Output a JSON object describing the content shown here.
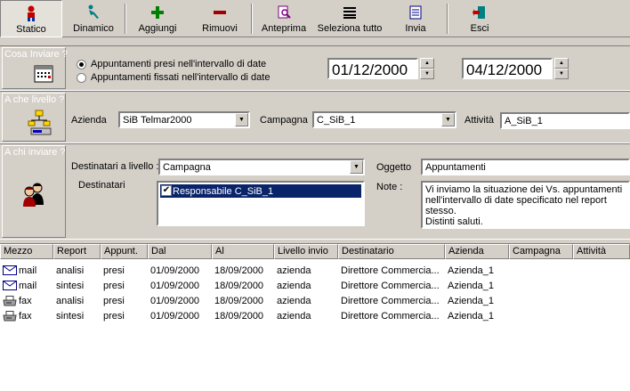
{
  "toolbar": {
    "statico": "Statico",
    "dinamico": "Dinamico",
    "aggiungi": "Aggiungi",
    "rimuovi": "Rimuovi",
    "anteprima": "Anteprima",
    "seleziona_tutto": "Seleziona tutto",
    "invia": "Invia",
    "esci": "Esci"
  },
  "cosa_inviare": {
    "title": "Cosa Inviare ?",
    "option1": "Appuntamenti presi nell'intervallo di date",
    "option2": "Appuntamenti fissati nell'intervallo di date",
    "date_from": "01/12/2000",
    "date_to": "04/12/2000"
  },
  "che_livello": {
    "title": "A che livello ?",
    "azienda_label": "Azienda",
    "azienda_value": "SiB Telmar2000",
    "campagna_label": "Campagna",
    "campagna_value": "C_SiB_1",
    "attivita_label": "Attività",
    "attivita_value": "A_SiB_1"
  },
  "chi_inviare": {
    "title": "A chi inviare ?",
    "destinatari_livello_label": "Destinatari a livello :",
    "destinatari_livello_value": "Campagna",
    "destinatari_label": "Destinatari",
    "destinatari_item": "Responsabile C_SiB_1",
    "oggetto_label": "Oggetto",
    "oggetto_value": "Appuntamenti",
    "note_label": "Note :",
    "note_line1": "Vi inviamo la situazione dei Vs. appuntamenti",
    "note_line2": "nell'intervallo di date specificato nel report stesso.",
    "note_line3": "Distinti saluti."
  },
  "grid": {
    "headers": [
      "Mezzo",
      "Report",
      "Appunt.",
      "Dal",
      "Al",
      "Livello invio",
      "Destinatario",
      "Azienda",
      "Campagna",
      "Attività"
    ],
    "rows": [
      [
        "mail",
        "analisi",
        "presi",
        "01/09/2000",
        "18/09/2000",
        "azienda",
        "Direttore Commercia...",
        "Azienda_1",
        "",
        ""
      ],
      [
        "mail",
        "sintesi",
        "presi",
        "01/09/2000",
        "18/09/2000",
        "azienda",
        "Direttore Commercia...",
        "Azienda_1",
        "",
        ""
      ],
      [
        "fax",
        "analisi",
        "presi",
        "01/09/2000",
        "18/09/2000",
        "azienda",
        "Direttore Commercia...",
        "Azienda_1",
        "",
        ""
      ],
      [
        "fax",
        "sintesi",
        "presi",
        "01/09/2000",
        "18/09/2000",
        "azienda",
        "Direttore Commercia...",
        "Azienda_1",
        "",
        ""
      ]
    ],
    "row_icons": [
      "mail-icon",
      "mail-icon",
      "fax-icon",
      "fax-icon"
    ]
  }
}
